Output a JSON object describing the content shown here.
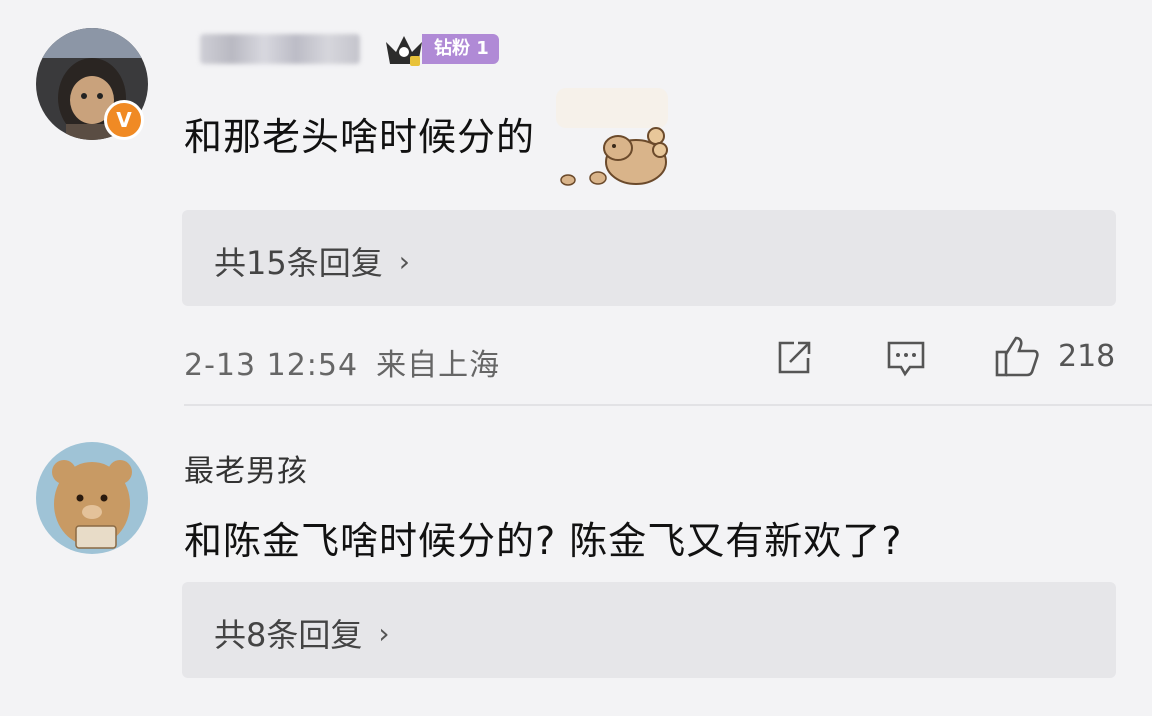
{
  "comments": [
    {
      "username": "",
      "fan_badge": "钻粉 1",
      "verified_mark": "V",
      "content": "和那老头啥时候分的",
      "replies_label": "共15条回复",
      "time": "2-13 12:54",
      "location": "来自上海",
      "likes": "218",
      "icons": [
        "share-icon",
        "comment-icon",
        "like-icon"
      ]
    },
    {
      "username": "最老男孩",
      "content": "和陈金飞啥时候分的? 陈金飞又有新欢了?",
      "replies_label": "共8条回复"
    }
  ],
  "colors": {
    "background": "#f3f3f5",
    "reply_box": "#e6e6e9",
    "fan_badge": "#b08ad6",
    "verified_badge": "#f08a24"
  },
  "chevron": "›"
}
